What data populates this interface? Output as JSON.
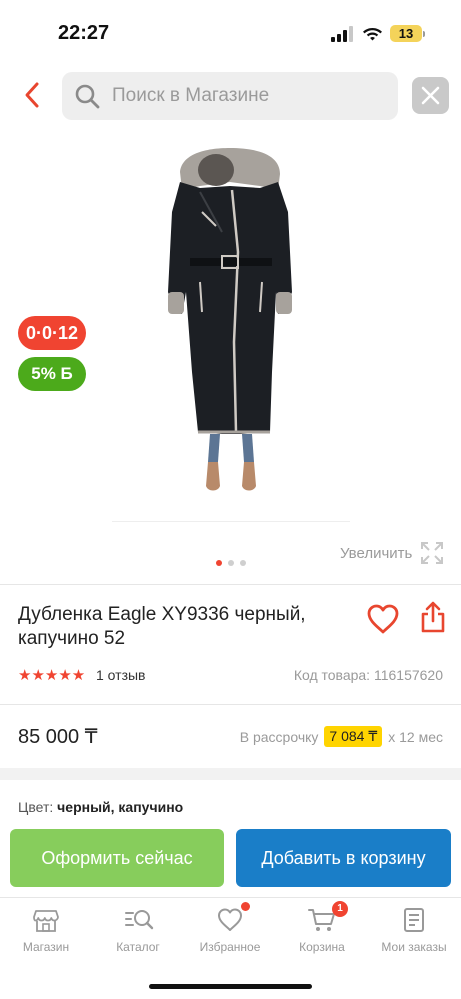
{
  "status_bar": {
    "time": "22:27",
    "battery": "13"
  },
  "search": {
    "placeholder": "Поиск в Магазине"
  },
  "badges": {
    "installment": "0·0·12",
    "bonus": "5% Б"
  },
  "gallery": {
    "zoom_label": "Увеличить",
    "total_slides": 3,
    "active_slide": 0
  },
  "product": {
    "title": "Дубленка Eagle XY9336 черный, капучино 52",
    "stars": "★★★★★",
    "rating": 5,
    "reviews": "1 отзыв",
    "sku": "Код товара: 116157620",
    "price": "85 000 ₸",
    "installment_prefix": "В рассрочку",
    "installment_amount": "7 084 ₸",
    "installment_suffix": "х 12 мес",
    "color_label": "Цвет:",
    "color_value": "черный, капучино"
  },
  "actions": {
    "order_now": "Оформить сейчас",
    "add_to_cart": "Добавить в корзину"
  },
  "tabs": [
    {
      "label": "Магазин",
      "icon": "shop-icon"
    },
    {
      "label": "Каталог",
      "icon": "catalog-icon"
    },
    {
      "label": "Избранное",
      "icon": "heart-icon"
    },
    {
      "label": "Корзина",
      "icon": "cart-icon",
      "badge": "1"
    },
    {
      "label": "Мои заказы",
      "icon": "orders-icon"
    }
  ],
  "colors": {
    "accent_red": "#f04431",
    "green": "#87cd5c",
    "blue": "#1a7ec8",
    "yellow": "#ffd400"
  }
}
